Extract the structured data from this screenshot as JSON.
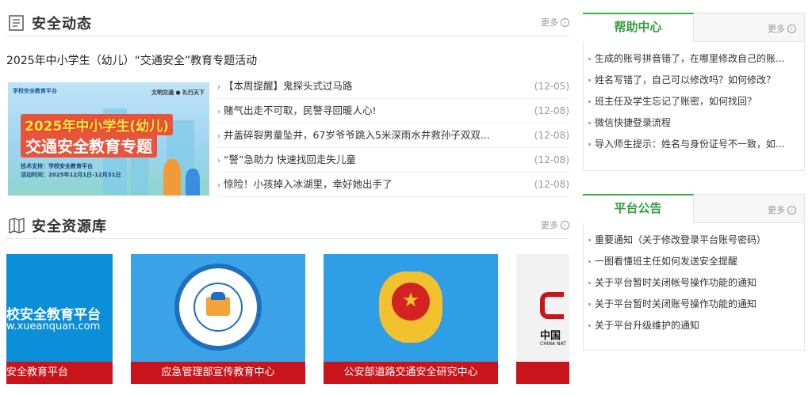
{
  "news_section": {
    "title": "安全动态",
    "more": "更多",
    "headline": "2025年中小学生（幼儿）“交通安全”教育专题活动",
    "banner": {
      "logo_text": "学校安全教育平台",
      "slogan": "文明交通 ● 礼行天下",
      "title_line1": "2025年中小学生(幼儿)",
      "title_line2": "交通安全教育专题",
      "support": "技术支持：学校安全教育平台",
      "period": "活动时间：2025年12月1日-12月31日"
    },
    "items": [
      {
        "title": "【本周提醒】鬼探头式过马路",
        "date": "(12-05)"
      },
      {
        "title": "赌气出走不可取，民警寻回暖人心!",
        "date": "(12-08)"
      },
      {
        "title": "井盖碎裂男童坠井，67岁爷爷跳入5米深雨水井救孙子双双...",
        "date": "(12-08)"
      },
      {
        "title": "“警”急助力 快速找回走失儿童",
        "date": "(12-08)"
      },
      {
        "title": "惊险！小孩掉入冰湖里，幸好她出手了",
        "date": "(12-08)"
      }
    ]
  },
  "resource_section": {
    "title": "安全资源库",
    "more": "更多",
    "cards": [
      {
        "caption": "安全教育平台",
        "logo_line1": "校安全教育平台",
        "logo_line2": "w.xueanquan.com"
      },
      {
        "caption": "应急管理部宣传教育中心",
        "emblem_text": "应急管理部宣传教育中心"
      },
      {
        "caption": "公安部道路交通安全研究中心"
      },
      {
        "caption": "",
        "logo_line1": "中国",
        "logo_line2": "CHINA NAT"
      }
    ]
  },
  "help_center": {
    "tab": "帮助中心",
    "more": "更多",
    "items": [
      "生成的账号拼音错了，在哪里修改自己的账...",
      "姓名写错了，自己可以修改吗？如何修改？",
      "班主任及学生忘记了账密，如何找回？",
      "微信快捷登录流程",
      "导入师生提示：姓名与身份证号不一致，如..."
    ]
  },
  "announcements": {
    "tab": "平台公告",
    "more": "更多",
    "items": [
      "重要通知（关于修改登录平台账号密码）",
      "一图看懂班主任如何发送安全提醒",
      "关于平台暂时关闭帐号操作功能的通知",
      "关于平台暂时关闭账号操作功能的通知",
      "关于平台升级维护的通知"
    ]
  },
  "colors": {
    "accent_green": "#3bb04a",
    "caption_red": "#c8141a",
    "link_blue": "#2a7fd4"
  }
}
